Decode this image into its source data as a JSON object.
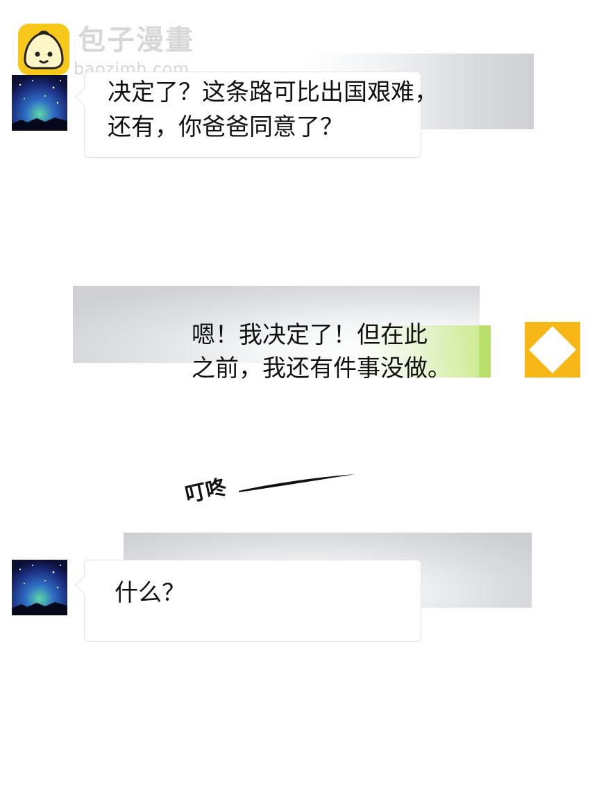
{
  "watermark": {
    "brand": "包子漫畫",
    "url": "baozimh.com"
  },
  "messages": [
    {
      "side": "left",
      "text": "决定了？这条路可比出国艰难，\n还有，你爸爸同意了？"
    },
    {
      "side": "right",
      "text": "嗯！我决定了！但在此\n之前，我还有件事没做。"
    },
    {
      "side": "left",
      "text": "什么？"
    }
  ],
  "sound_effect": "叮咚",
  "colors": {
    "logo_yellow": "#f7c71a",
    "self_avatar": "#f7b817",
    "bubble_green": "#b9e06a",
    "text": "#111111"
  },
  "icons": {
    "logo": "bun-face-icon",
    "avatar_other": "starry-sky-avatar",
    "avatar_self": "yellow-diamond-avatar"
  }
}
